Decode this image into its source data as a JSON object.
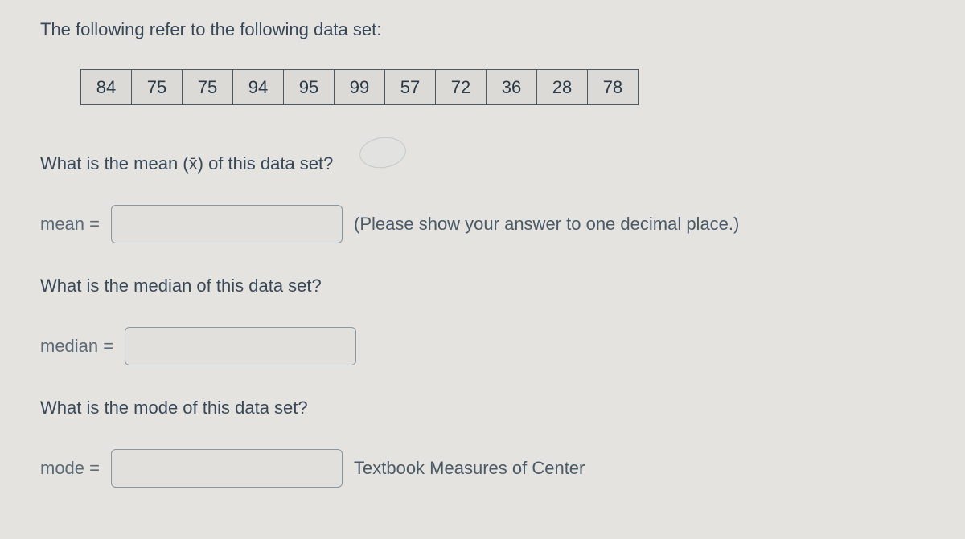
{
  "intro": "The following refer to the following data set:",
  "data_values": [
    "84",
    "75",
    "75",
    "94",
    "95",
    "99",
    "57",
    "72",
    "36",
    "28",
    "78"
  ],
  "q_mean": "What is the mean (x̄) of this data set?",
  "label_mean": "mean =",
  "hint_mean": "(Please show your answer to one decimal place.)",
  "q_median": "What is the median of this data set?",
  "label_median": "median =",
  "q_mode": "What is the mode of this data set?",
  "label_mode": "mode =",
  "textbook_link": "Textbook Measures of Center"
}
